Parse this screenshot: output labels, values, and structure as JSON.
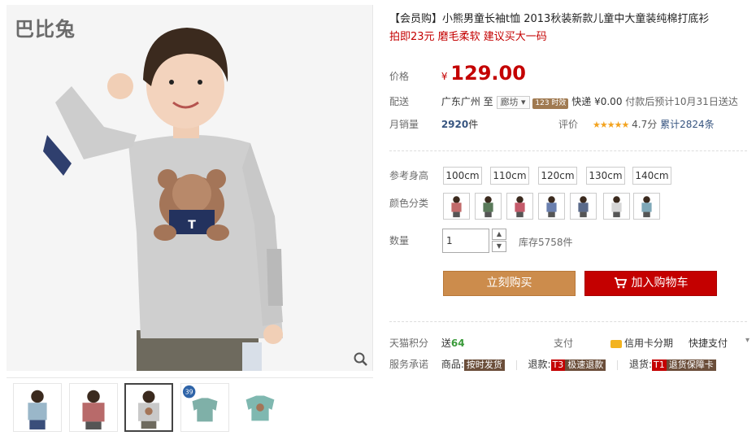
{
  "gallery": {
    "logo": "巴比兔",
    "zoom_icon": "magnifier-icon",
    "thumbnails": [
      {
        "name": "thumb-1",
        "color": "#9ab7c9"
      },
      {
        "name": "thumb-2",
        "color": "#b86a6a"
      },
      {
        "name": "thumb-3",
        "color": "#bfbfbf"
      },
      {
        "name": "thumb-4",
        "color": "#7fb0a8",
        "badge": "39"
      },
      {
        "name": "thumb-5",
        "color": "#7fb8b0"
      }
    ]
  },
  "product": {
    "title": "【会员购】小熊男童长袖t恤 2013秋装新款儿童中大童装纯棉打底衫",
    "promo": "拍即23元 磨毛柔软 建议买大一码"
  },
  "price": {
    "label": "价格",
    "currency": "¥",
    "value": "129.00"
  },
  "shipping": {
    "label": "配送",
    "from": "广东广州",
    "to_word": "至",
    "to": "廊坊",
    "timing_badge": "123 时效",
    "method": "快递",
    "fee": "¥0.00",
    "eta": "付款后预计10月31日送达"
  },
  "sales": {
    "label": "月销量",
    "value": "2920",
    "unit": "件",
    "rating_label": "评价",
    "stars": "★★★★★",
    "rating": "4.7分",
    "total": "累计2824条"
  },
  "sizes": {
    "label": "参考身高",
    "options": [
      "100cm",
      "110cm",
      "120cm",
      "130cm",
      "140cm"
    ]
  },
  "colors": {
    "label": "颜色分类",
    "options": [
      "#c26b6b",
      "#5a7a5a",
      "#c45a6a",
      "#6a7fae",
      "#5a6a8a",
      "#d6d6d6",
      "#7fa8b8"
    ]
  },
  "quantity": {
    "label": "数量",
    "value": "1",
    "stock": "库存5758件"
  },
  "actions": {
    "buy": "立刻购买",
    "cart": "加入购物车"
  },
  "footer": {
    "points_label": "天猫积分",
    "points_prefix": "送",
    "points_value": "64",
    "pay_label": "支付",
    "credit_card": "信用卡分期",
    "quick_pay": "快捷支付",
    "service_label": "服务承诺",
    "goods_prefix": "商品:",
    "goods_tag": "按时发货",
    "refund_prefix": "退款:",
    "refund_code": "T3",
    "refund_tag": "极速退款",
    "return_prefix": "退货:",
    "return_code": "T1",
    "return_tag": "退货保障卡"
  }
}
